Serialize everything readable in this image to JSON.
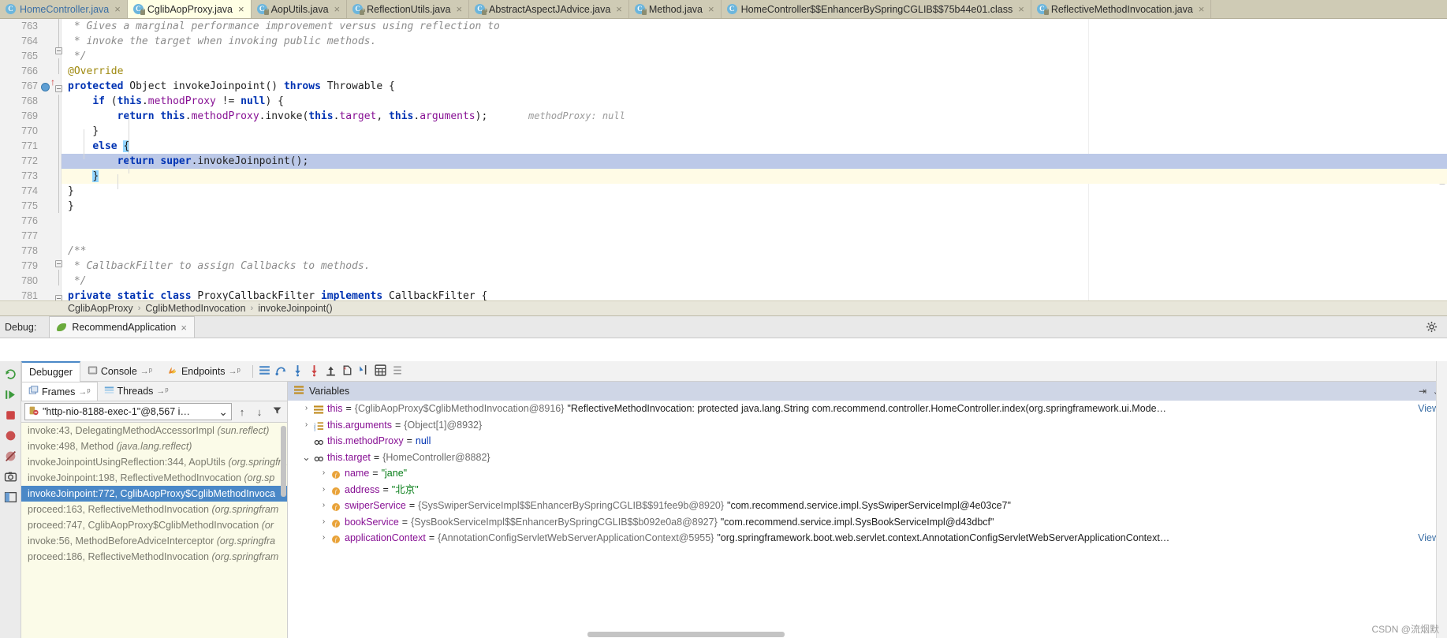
{
  "editor_tabs": [
    {
      "label": "HomeController.java",
      "icon": "java-class-icon",
      "active": false,
      "library": false,
      "accent": true
    },
    {
      "label": "CglibAopProxy.java",
      "icon": "java-class-icon",
      "active": true,
      "library": true,
      "accent": false
    },
    {
      "label": "AopUtils.java",
      "icon": "java-class-icon",
      "active": false,
      "library": true,
      "accent": false
    },
    {
      "label": "ReflectionUtils.java",
      "icon": "java-class-icon",
      "active": false,
      "library": true,
      "accent": false
    },
    {
      "label": "AbstractAspectJAdvice.java",
      "icon": "java-class-icon",
      "active": false,
      "library": true,
      "accent": false
    },
    {
      "label": "Method.java",
      "icon": "java-class-icon",
      "active": false,
      "library": true,
      "accent": false
    },
    {
      "label": "HomeController$$EnhancerBySpringCGLIB$$75b44e01.class",
      "icon": "java-class-icon",
      "active": false,
      "library": false,
      "accent": false
    },
    {
      "label": "ReflectiveMethodInvocation.java",
      "icon": "java-class-icon",
      "active": false,
      "library": true,
      "accent": false
    }
  ],
  "tab_close_glyph": "×",
  "editor": {
    "first_line": 763,
    "inline_hint": "methodProxy: null",
    "lines": [
      {
        "num": "763",
        "text": " * Gives a marginal performance improvement versus using reflection to",
        "style": "comment"
      },
      {
        "num": "764",
        "text": " * invoke the target when invoking public methods.",
        "style": "comment"
      },
      {
        "num": "765",
        "text": " */",
        "style": "comment"
      },
      {
        "num": "766",
        "text": "@Override",
        "style": "annotation"
      },
      {
        "num": "767",
        "text": "protected Object invokeJoinpoint() throws Throwable {",
        "style": "code"
      },
      {
        "num": "768",
        "text": "    if (this.methodProxy != null) {",
        "style": "code"
      },
      {
        "num": "769",
        "text": "        return this.methodProxy.invoke(this.target, this.arguments);",
        "style": "code"
      },
      {
        "num": "770",
        "text": "    }",
        "style": "code"
      },
      {
        "num": "771",
        "text": "    else {",
        "style": "code"
      },
      {
        "num": "772",
        "text": "        return super.invokeJoinpoint();",
        "style": "code"
      },
      {
        "num": "773",
        "text": "    }",
        "style": "code"
      },
      {
        "num": "774",
        "text": "}",
        "style": "code"
      },
      {
        "num": "775",
        "text": "}",
        "style": "code"
      },
      {
        "num": "776",
        "text": "",
        "style": "code"
      },
      {
        "num": "777",
        "text": "",
        "style": "code"
      },
      {
        "num": "778",
        "text": "/**",
        "style": "comment"
      },
      {
        "num": "779",
        "text": " * CallbackFilter to assign Callbacks to methods.",
        "style": "comment"
      },
      {
        "num": "780",
        "text": " */",
        "style": "comment"
      },
      {
        "num": "781",
        "text": "private static class ProxyCallbackFilter implements CallbackFilter {",
        "style": "code"
      }
    ]
  },
  "breadcrumb": {
    "items": [
      "CglibAopProxy",
      "CglibMethodInvocation",
      "invokeJoinpoint()"
    ],
    "separator": "›"
  },
  "debug_header": {
    "label": "Debug:",
    "session_tab": "RecommendApplication",
    "close_glyph": "×",
    "settings_icon": "gear-icon"
  },
  "debug_tabs": [
    {
      "label": "Debugger",
      "icon": "debugger-icon",
      "active": true,
      "pin": false
    },
    {
      "label": "Console",
      "icon": "console-icon",
      "active": false,
      "pin": true
    },
    {
      "label": "Endpoints",
      "icon": "endpoints-icon",
      "active": false,
      "pin": true
    }
  ],
  "stepping_toolbar": [
    {
      "name": "layout-settings-icon"
    },
    {
      "name": "step-over-icon"
    },
    {
      "name": "step-into-icon"
    },
    {
      "name": "force-step-into-icon"
    },
    {
      "name": "step-out-icon"
    },
    {
      "name": "drop-frame-icon"
    },
    {
      "name": "run-to-cursor-icon"
    },
    {
      "name": "evaluate-expression-icon"
    },
    {
      "name": "mute-breakpoints-icon"
    }
  ],
  "left_rail": [
    {
      "name": "rerun-icon"
    },
    {
      "name": "resume-program-icon"
    },
    {
      "name": "stop-icon"
    },
    {
      "name": "view-breakpoints-icon"
    },
    {
      "name": "mute-breakpoints-rail-icon"
    },
    {
      "name": "screenshot-icon"
    },
    {
      "name": "layout-icon"
    }
  ],
  "frames_panel": {
    "tabs": [
      {
        "label": "Frames",
        "icon": "frames-icon",
        "active": true,
        "pin": true
      },
      {
        "label": "Threads",
        "icon": "threads-icon",
        "active": false,
        "pin": true
      }
    ],
    "thread_selector": {
      "value": "\"http-nio-8188-exec-1\"@8,567 i…",
      "icon": "thread-suspended-icon",
      "chevron": "⌄"
    },
    "buttons": [
      {
        "name": "move-frame-up-button",
        "glyph": "↑"
      },
      {
        "name": "move-frame-down-button",
        "glyph": "↓"
      },
      {
        "name": "filter-frames-button",
        "glyph": "filter-icon"
      }
    ],
    "frames": [
      {
        "method": "invoke:43, DelegatingMethodAccessorImpl ",
        "pkg": "(sun.reflect)",
        "selected": false
      },
      {
        "method": "invoke:498, Method ",
        "pkg": "(java.lang.reflect)",
        "selected": false
      },
      {
        "method": "invokeJoinpointUsingReflection:344, AopUtils ",
        "pkg": "(org.springfra",
        "selected": false
      },
      {
        "method": "invokeJoinpoint:198, ReflectiveMethodInvocation ",
        "pkg": "(org.sp",
        "selected": false
      },
      {
        "method": "invokeJoinpoint:772, CglibAopProxy$CglibMethodInvoca",
        "pkg": "",
        "selected": true
      },
      {
        "method": "proceed:163, ReflectiveMethodInvocation ",
        "pkg": "(org.springfram",
        "selected": false
      },
      {
        "method": "proceed:747, CglibAopProxy$CglibMethodInvocation ",
        "pkg": "(or",
        "selected": false
      },
      {
        "method": "invoke:56, MethodBeforeAdviceInterceptor ",
        "pkg": "(org.springfra",
        "selected": false
      },
      {
        "method": "proceed:186, ReflectiveMethodInvocation ",
        "pkg": "(org.springfram",
        "selected": false
      }
    ]
  },
  "variables_panel": {
    "title": "Variables",
    "title_icon": "variables-icon",
    "expand_icon": "⇥",
    "chevron": "⌄",
    "view_label": "View",
    "rows": [
      {
        "twisty": "›",
        "icon": "stack-icon",
        "indent": 0,
        "name": "this",
        "ref": "{CglibAopProxy$CglibMethodInvocation@8916}",
        "value": "\"ReflectiveMethodInvocation: protected java.lang.String com.recommend.controller.HomeController.index(org.springframework.ui.Mode…",
        "value_kind": "plain",
        "view": true
      },
      {
        "twisty": "›",
        "icon": "array-icon",
        "indent": 0,
        "name": "this.arguments",
        "ref": "{Object[1]@8932}",
        "value": "",
        "value_kind": "plain",
        "view": false
      },
      {
        "twisty": "",
        "icon": "field-ref-icon",
        "indent": 0,
        "name": "this.methodProxy",
        "ref": "",
        "value": "null",
        "value_kind": "null",
        "view": false
      },
      {
        "twisty": "⌄",
        "icon": "field-ref-icon",
        "indent": 0,
        "name": "this.target",
        "ref": "{HomeController@8882}",
        "value": "",
        "value_kind": "plain",
        "view": false
      },
      {
        "twisty": "›",
        "icon": "field-icon",
        "indent": 1,
        "name": "name",
        "ref": "",
        "value": "\"jane\"",
        "value_kind": "string",
        "view": false
      },
      {
        "twisty": "›",
        "icon": "field-icon",
        "indent": 1,
        "name": "address",
        "ref": "",
        "value": "\"北京\"",
        "value_kind": "string",
        "view": false
      },
      {
        "twisty": "›",
        "icon": "field-icon",
        "indent": 1,
        "name": "swiperService",
        "ref": "{SysSwiperServiceImpl$$EnhancerBySpringCGLIB$$91fee9b@8920}",
        "value": "\"com.recommend.service.impl.SysSwiperServiceImpl@4e03ce7\"",
        "value_kind": "plain",
        "view": false
      },
      {
        "twisty": "›",
        "icon": "field-icon",
        "indent": 1,
        "name": "bookService",
        "ref": "{SysBookServiceImpl$$EnhancerBySpringCGLIB$$b092e0a8@8927}",
        "value": "\"com.recommend.service.impl.SysBookServiceImpl@d43dbcf\"",
        "value_kind": "plain",
        "view": false
      },
      {
        "twisty": "›",
        "icon": "field-icon",
        "indent": 1,
        "name": "applicationContext",
        "ref": "{AnnotationConfigServletWebServerApplicationContext@5955}",
        "value": "\"org.springframework.boot.web.servlet.context.AnnotationConfigServletWebServerApplicationContext…",
        "value_kind": "plain",
        "view": true
      }
    ]
  },
  "watermark": "CSDN @流烟默",
  "colors": {
    "tab_bar": "#cfcbb5",
    "active_tab": "#ffffe4",
    "exec_line": "#bcc9e8",
    "selection": "#4a88c7",
    "frames_bg": "#fbfbe8",
    "vars_header": "#cfd6e6"
  }
}
